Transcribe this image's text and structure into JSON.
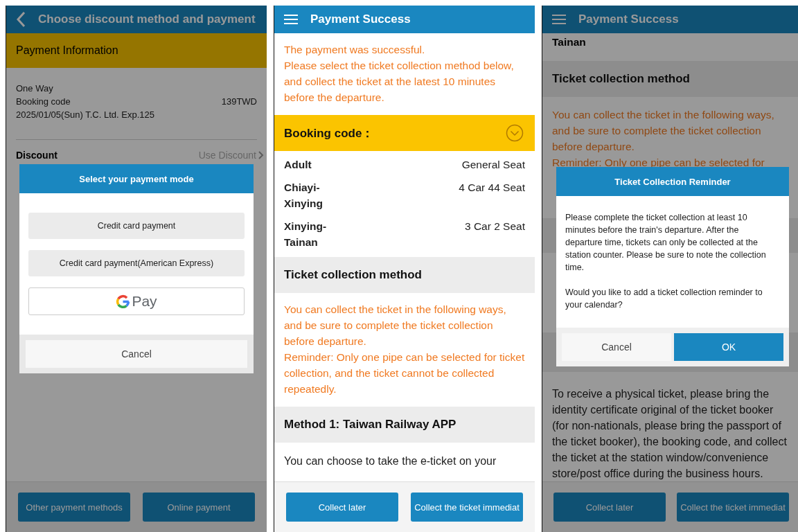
{
  "payment_screen": {
    "title": "Choose discount method and payment",
    "section": "Payment Information",
    "trip_type": "One Way",
    "booking_label": "Booking code",
    "price": "139TWD",
    "train": "2025/01/05(Sun) T.C. Ltd. Exp.125",
    "discount_label": "Discount",
    "discount_link": "Use Discount",
    "buttons": [
      "Other payment methods",
      "Online payment"
    ],
    "dialog": {
      "title": "Select your payment mode",
      "options": [
        {
          "kind": "plain",
          "label": "Credit card payment"
        },
        {
          "kind": "plain",
          "label": "Credit card payment(American Express)"
        },
        {
          "kind": "gpay",
          "label": "Pay"
        }
      ],
      "cancel": "Cancel"
    }
  },
  "success_screen": {
    "title": "Payment Success",
    "status": "The payment was successful.",
    "instruction": "Please select the ticket collection method below, and collect the ticket at the latest 10 minutes before the departure.",
    "booking_code_label": "Booking code：",
    "expanded": false,
    "rows": [
      {
        "label": "Adult",
        "value": "General Seat"
      },
      {
        "label": "Chiayi-Xinying",
        "value": "4 Car 44 Seat"
      },
      {
        "label": "Xinying-Tainan",
        "value": "3 Car 2 Seat"
      }
    ],
    "collection_heading": "Ticket collection method",
    "collection_notes": [
      "You can collect the ticket in the following ways, and be sure to complete the ticket collection before departure.",
      "Reminder: Only one pipe can be selected for ticket collection, and the ticket cannot be collected repeatedly."
    ],
    "method_heading": "Method 1: Taiwan Railway APP",
    "method_text": "You can choose to take the e-ticket on your",
    "buttons": [
      "Collect later",
      "Collect the ticket immediat"
    ]
  },
  "reminder_screen": {
    "title": "Payment Success",
    "station": "Tainan",
    "collection_heading": "Ticket collection method",
    "collection_notes": [
      "You can collect the ticket in the following ways, and be sure to complete the ticket collection before departure.",
      "Reminder: Only one pipe can be selected for"
    ],
    "physical_ticket_text": "To receive a physical ticket, please bring the identity certificate original of the ticket booker (for non-nationals, please bring the passport of the ticket booker), the booking code, and collect the ticket at the station window/convenience store/post office during the business hours.",
    "buttons": [
      "Collect later",
      "Collect the ticket immediat"
    ],
    "dialog": {
      "title": "Ticket Collection Reminder",
      "paragraphs": [
        "Please complete the ticket collection at least 10 minutes before the train's departure. After the departure time, tickets can only be collected at the station counter. Please be sure to note the collection time.",
        "Would you like to add a ticket collection reminder to your calendar?"
      ],
      "buttons": [
        {
          "label": "Cancel",
          "selected": false
        },
        {
          "label": "OK",
          "selected": true
        }
      ]
    }
  }
}
